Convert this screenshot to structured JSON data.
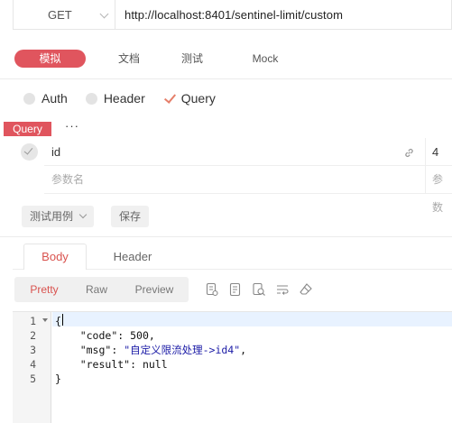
{
  "request": {
    "method": "GET",
    "url": "http://localhost:8401/sentinel-limit/custom"
  },
  "mode_tabs": [
    "模拟",
    "文档",
    "测试",
    "Mock"
  ],
  "auth_options": [
    {
      "label": "Auth",
      "selected": false
    },
    {
      "label": "Header",
      "selected": false
    },
    {
      "label": "Query",
      "selected": true
    }
  ],
  "query": {
    "tag": "Query",
    "more": "···",
    "params": [
      {
        "key": "id",
        "value": "4"
      }
    ],
    "placeholder_key": "参数名",
    "placeholder_value": "参数"
  },
  "actions": {
    "test_case": "测试用例",
    "save": "保存"
  },
  "response_tabs": [
    "Body",
    "Header"
  ],
  "format_tabs": [
    "Pretty",
    "Raw",
    "Preview"
  ],
  "toolbar_icons": [
    "copy-icon",
    "format-icon",
    "search-icon",
    "wrap-icon",
    "clear-icon"
  ],
  "code": {
    "line_numbers": [
      "1",
      "2",
      "3",
      "4",
      "5"
    ],
    "open": "{",
    "code_key": "\"code\"",
    "code_val": "500",
    "msg_key": "\"msg\"",
    "msg_val": "\"自定义限流处理->id4\"",
    "result_key": "\"result\"",
    "result_val": "null",
    "close": "}"
  },
  "colors": {
    "accent": "#e0555e",
    "active_text": "#d9534f",
    "string": "#1a1aa6"
  }
}
